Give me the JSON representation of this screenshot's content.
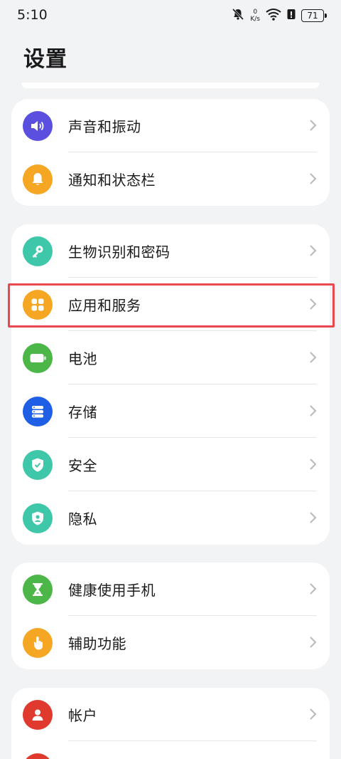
{
  "status_bar": {
    "time": "5:10",
    "net_speed_value": "0",
    "net_speed_unit": "K/s",
    "battery_level": "71"
  },
  "page": {
    "title": "设置"
  },
  "groups": [
    {
      "items": [
        {
          "label": "声音和振动",
          "icon": "volume-icon",
          "color": "#5b4fe0"
        },
        {
          "label": "通知和状态栏",
          "icon": "bell-icon",
          "color": "#f5a623"
        }
      ]
    },
    {
      "items": [
        {
          "label": "生物识别和密码",
          "icon": "key-icon",
          "color": "#3ec7a8"
        },
        {
          "label": "应用和服务",
          "icon": "apps-grid-icon",
          "color": "#f5a623",
          "highlighted": true
        },
        {
          "label": "电池",
          "icon": "battery-icon",
          "color": "#4cb748"
        },
        {
          "label": "存储",
          "icon": "storage-icon",
          "color": "#1f5fe6"
        },
        {
          "label": "安全",
          "icon": "shield-check-icon",
          "color": "#3ec7a8"
        },
        {
          "label": "隐私",
          "icon": "shield-user-icon",
          "color": "#3ec7a8"
        }
      ]
    },
    {
      "items": [
        {
          "label": "健康使用手机",
          "icon": "hourglass-icon",
          "color": "#4cb748"
        },
        {
          "label": "辅助功能",
          "icon": "hand-pointer-icon",
          "color": "#f5a623"
        }
      ]
    },
    {
      "items": [
        {
          "label": "帐户",
          "icon": "account-icon",
          "color": "#e0392d"
        }
      ]
    }
  ]
}
